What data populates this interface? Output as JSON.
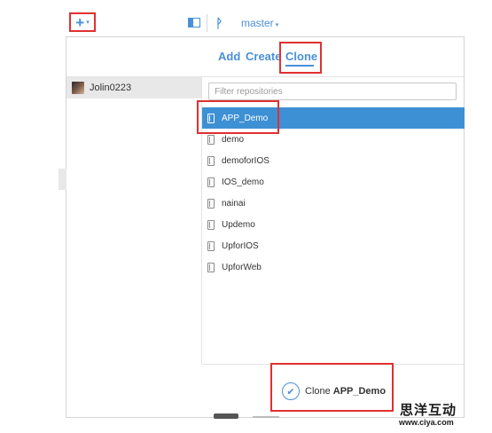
{
  "toolbar": {
    "plus_icon": "plus-icon",
    "plus_glyph": "+",
    "caret_glyph": "▾",
    "branch_glyph": "ᚹ",
    "branch_label": "master"
  },
  "tabs": {
    "add": "Add",
    "create": "Create",
    "clone": "Clone",
    "active": "Clone"
  },
  "accounts": [
    {
      "name": "Jolin0223"
    }
  ],
  "filter": {
    "placeholder": "Filter repositories",
    "value": ""
  },
  "repositories": [
    {
      "name": "APP_Demo",
      "selected": true
    },
    {
      "name": "demo"
    },
    {
      "name": "demoforIOS"
    },
    {
      "name": "IOS_demo"
    },
    {
      "name": "nainai"
    },
    {
      "name": "Updemo"
    },
    {
      "name": "UpforIOS"
    },
    {
      "name": "UpforWeb"
    }
  ],
  "clone_action": {
    "label": "Clone",
    "repo": "APP_Demo",
    "check_glyph": "✔"
  },
  "watermark": {
    "main": "思洋互动",
    "url": "www.ciya.com"
  },
  "colors": {
    "accent": "#4a90d9",
    "selected_row": "#3e90d4",
    "highlight_box": "#e03030"
  }
}
